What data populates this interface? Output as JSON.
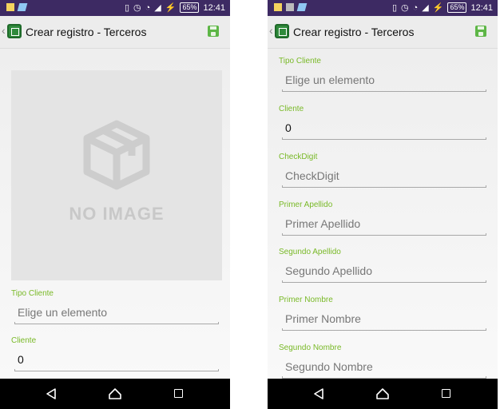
{
  "status": {
    "time": "12:41",
    "battery": "65%"
  },
  "actionbar": {
    "title": "Crear registro - Terceros"
  },
  "image_placeholder": {
    "text": "NO IMAGE"
  },
  "left_fields": [
    {
      "label": "Tipo Cliente",
      "value": "Elige un elemento"
    },
    {
      "label": "Cliente",
      "value": "0"
    }
  ],
  "right_fields": [
    {
      "label": "Tipo Cliente",
      "value": "Elige un elemento"
    },
    {
      "label": "Cliente",
      "value": "0"
    },
    {
      "label": "CheckDigit",
      "value": "CheckDigit"
    },
    {
      "label": "Primer Apellido",
      "value": "Primer Apellido"
    },
    {
      "label": "Segundo Apellido",
      "value": "Segundo Apellido"
    },
    {
      "label": "Primer Nombre",
      "value": "Primer Nombre"
    },
    {
      "label": "Segundo Nombre",
      "value": "Segundo Nombre"
    }
  ],
  "colors": {
    "statusbar": "#3d2a63",
    "label_green": "#79b927",
    "save_icon": "#5db646"
  },
  "icons": [
    "back-chevron-icon",
    "app-icon",
    "save-icon",
    "nav-back-icon",
    "nav-home-icon",
    "nav-recent-icon"
  ]
}
